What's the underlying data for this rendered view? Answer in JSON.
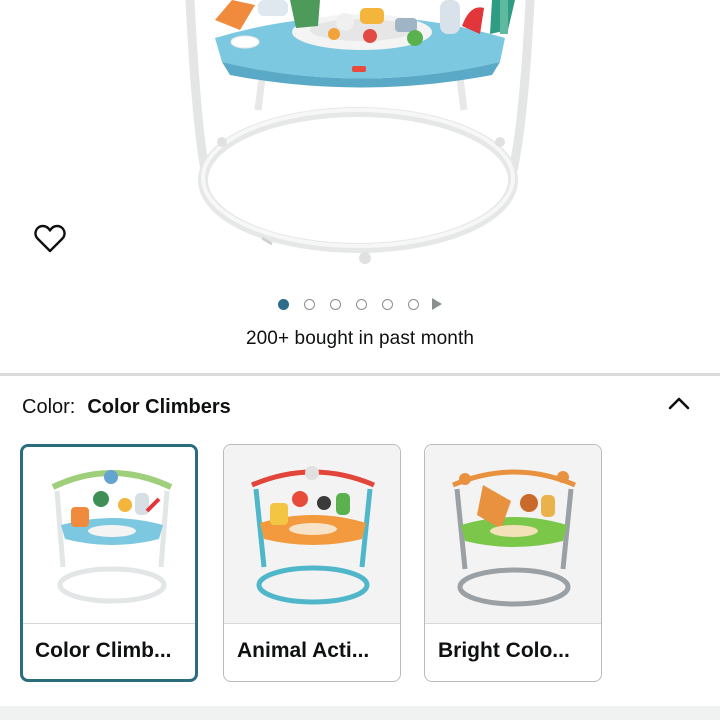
{
  "product": {
    "wishlist_icon": "heart-icon",
    "carousel": {
      "total_images": 6,
      "active_index": 0,
      "more_icon": "play-icon"
    },
    "social_proof": "200+ bought in past month"
  },
  "variation": {
    "label": "Color:",
    "selected_value": "Color Climbers",
    "collapse_icon": "chevron-up-icon",
    "options": [
      {
        "name": "Color Climb...",
        "selected": true
      },
      {
        "name": "Animal Acti...",
        "selected": false
      },
      {
        "name": "Bright Colo...",
        "selected": false
      }
    ]
  },
  "colors": {
    "accent": "#2b6d7f",
    "active_dot": "#2d6c8a",
    "divider": "#dcdcdc"
  }
}
